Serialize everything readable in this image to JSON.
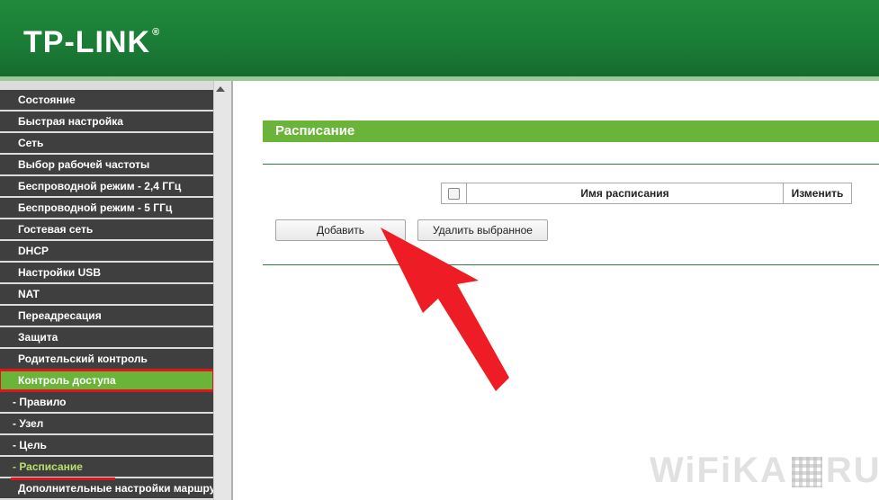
{
  "header": {
    "logo": "TP-LINK",
    "logo_mark": "®"
  },
  "sidebar": {
    "items": [
      {
        "label": "Состояние",
        "type": "main"
      },
      {
        "label": "Быстрая настройка",
        "type": "main"
      },
      {
        "label": "Сеть",
        "type": "main"
      },
      {
        "label": "Выбор рабочей частоты",
        "type": "main"
      },
      {
        "label": "Беспроводной режим - 2,4 ГГц",
        "type": "main"
      },
      {
        "label": "Беспроводной режим - 5 ГГц",
        "type": "main"
      },
      {
        "label": "Гостевая сеть",
        "type": "main"
      },
      {
        "label": "DHCP",
        "type": "main"
      },
      {
        "label": "Настройки USB",
        "type": "main"
      },
      {
        "label": "NAT",
        "type": "main"
      },
      {
        "label": "Переадресация",
        "type": "main"
      },
      {
        "label": "Защита",
        "type": "main"
      },
      {
        "label": "Родительский контроль",
        "type": "main"
      },
      {
        "label": "Контроль доступа",
        "type": "active"
      },
      {
        "label": "- Правило",
        "type": "sub"
      },
      {
        "label": "- Узел",
        "type": "sub"
      },
      {
        "label": "- Цель",
        "type": "sub"
      },
      {
        "label": "- Расписание",
        "type": "sub-current"
      },
      {
        "label": "Дополнительные настройки маршрутизации",
        "type": "main"
      }
    ]
  },
  "main": {
    "section_title": "Расписание",
    "table": {
      "col_name": "Имя расписания",
      "col_edit": "Изменить"
    },
    "buttons": {
      "add": "Добавить",
      "delete_selected": "Удалить выбранное"
    }
  },
  "watermark": {
    "left": "WiFiKA",
    "right": "RU"
  },
  "colors": {
    "header_green": "#1a7c35",
    "accent_green": "#6bb43a",
    "menu_dark": "#3f3f3f",
    "highlight_red": "#e0141e"
  }
}
